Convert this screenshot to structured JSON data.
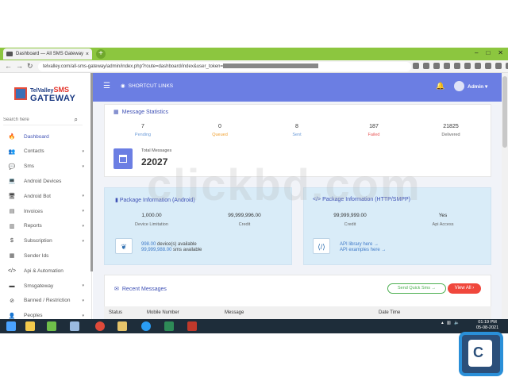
{
  "browser": {
    "tab_title": "Dashboard — All SMS Gateway",
    "tab_close": "×",
    "new_tab": "+",
    "url_prefix": "telvalley.com/all-sms-gateway/admin/index.php?route=dashboard/index&user_token=",
    "window_buttons": [
      "–",
      "□",
      "✕"
    ]
  },
  "logo": {
    "line1": "TelValley",
    "line1_accent": "SMS",
    "line2": "GATEWAY"
  },
  "search": {
    "placeholder": "Search here"
  },
  "sidebar": {
    "items": [
      {
        "label": "Dashboard",
        "icon": "fire-icon",
        "glyph": "🔥",
        "arrow": ""
      },
      {
        "label": "Contacts",
        "icon": "contacts-icon",
        "glyph": "👥",
        "arrow": "▾"
      },
      {
        "label": "Sms",
        "icon": "chat-icon",
        "glyph": "💬",
        "arrow": "▾"
      },
      {
        "label": "Android Devices",
        "icon": "laptop-icon",
        "glyph": "💻",
        "arrow": ""
      },
      {
        "label": "Android Bot",
        "icon": "bot-icon",
        "glyph": "🖥",
        "arrow": "▾"
      },
      {
        "label": "Invoices",
        "icon": "file-icon",
        "glyph": "▤",
        "arrow": "▾"
      },
      {
        "label": "Reports",
        "icon": "chart-icon",
        "glyph": "▥",
        "arrow": "▾"
      },
      {
        "label": "Subscription",
        "icon": "dollar-icon",
        "glyph": "$",
        "arrow": "▾"
      },
      {
        "label": "Sender Ids",
        "icon": "id-icon",
        "glyph": "▦",
        "arrow": ""
      },
      {
        "label": "Api & Automation",
        "icon": "code-icon",
        "glyph": "</>",
        "arrow": ""
      },
      {
        "label": "Smsgateway",
        "icon": "server-icon",
        "glyph": "▬",
        "arrow": "▾"
      },
      {
        "label": "Banned / Restriction",
        "icon": "ban-icon",
        "glyph": "⊘",
        "arrow": "▾"
      },
      {
        "label": "Peoples",
        "icon": "user-icon",
        "glyph": "👤",
        "arrow": "▾"
      }
    ]
  },
  "topbar": {
    "shortcut_label": "SHORTCUT LINKS",
    "user": "Admin"
  },
  "stats": {
    "title": "Message Statistics",
    "items": [
      {
        "value": "7",
        "label": "Pending",
        "color": "#6b9bd8"
      },
      {
        "value": "0",
        "label": "Queued",
        "color": "#f0a030"
      },
      {
        "value": "8",
        "label": "Sent",
        "color": "#6b9bd8"
      },
      {
        "value": "187",
        "label": "Failed",
        "color": "#e85a5a"
      },
      {
        "value": "21825",
        "label": "Delivered",
        "color": "#666666"
      }
    ],
    "total_label": "Total Messages",
    "total_value": "22027"
  },
  "package_android": {
    "title": "Package Information (Android)",
    "limit_value": "1,000.00",
    "limit_label": "Device Limitation",
    "credit_value": "99,999,996.00",
    "credit_label": "Credit",
    "devices_num": "998.00",
    "devices_text": "device(s) available",
    "sms_num": "99,999,988.00",
    "sms_text": "sms available"
  },
  "package_http": {
    "title": "Package Information (HTTP/SMPP)",
    "credit_value": "99,999,999.00",
    "credit_label": "Credit",
    "api_value": "Yes",
    "api_label": "Api Access",
    "link1": "API library here →",
    "link2": "API examples here →"
  },
  "recent": {
    "title": "Recent Messages",
    "quick_btn": "Send Quick Sms →",
    "viewall_btn": "View All",
    "columns": [
      "Status",
      "Mobile Number",
      "Message",
      "Date Time"
    ]
  },
  "taskbar": {
    "time": "01:19 PM",
    "date": "05-08-2021"
  },
  "watermark": {
    "text": "clickbd.com",
    "badge": "C"
  }
}
